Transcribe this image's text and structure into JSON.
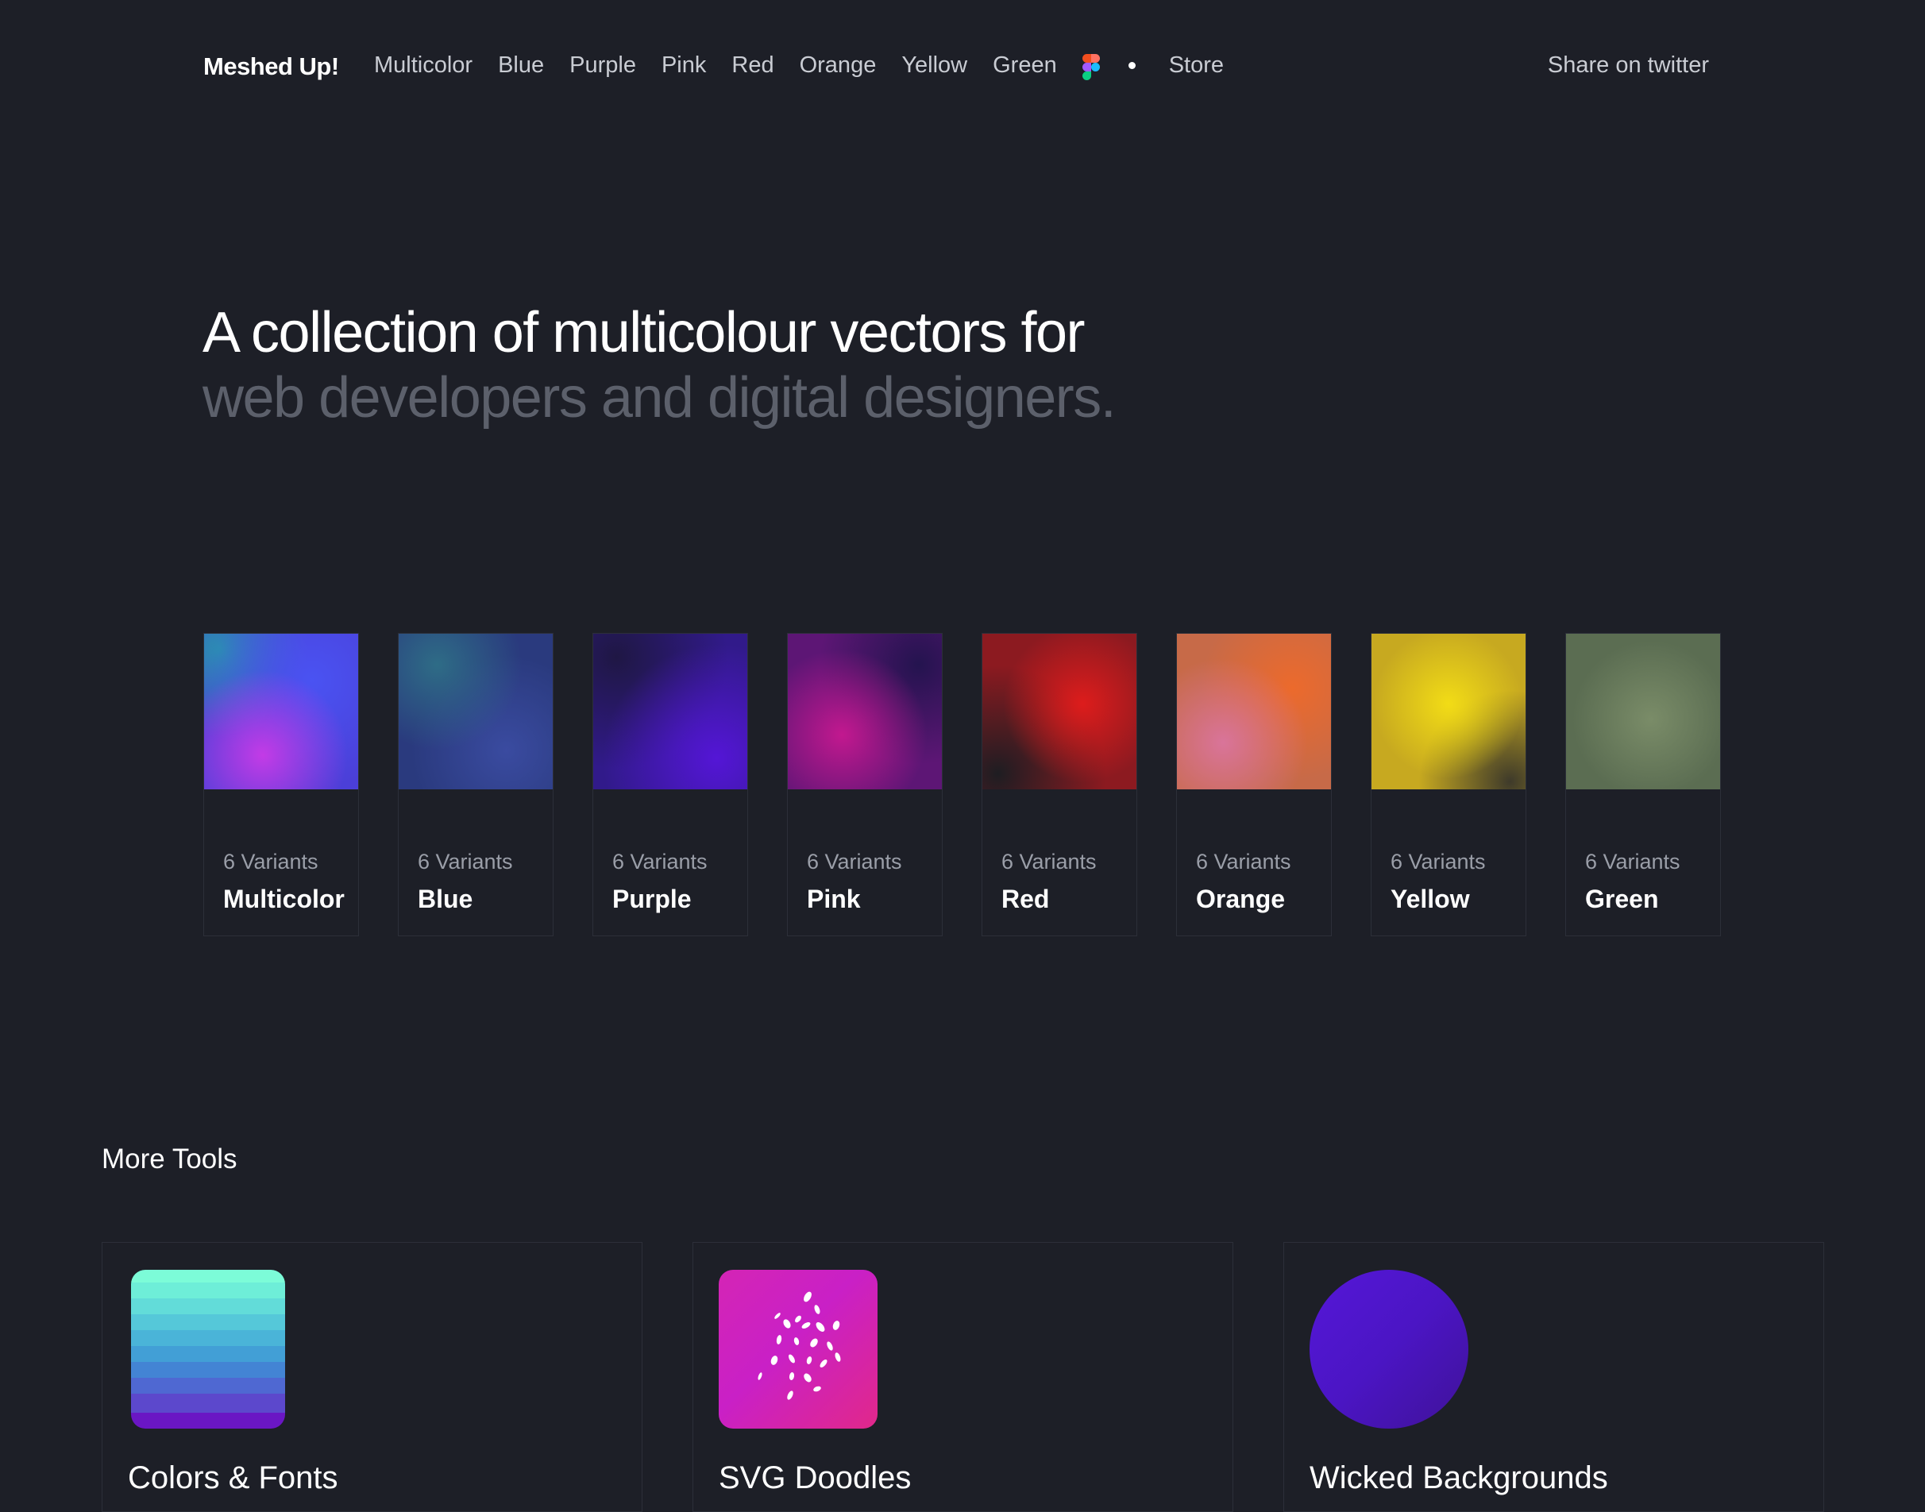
{
  "nav": {
    "brand": "Meshed Up!",
    "links": [
      "Multicolor",
      "Blue",
      "Purple",
      "Pink",
      "Red",
      "Orange",
      "Yellow",
      "Green"
    ],
    "figma_icon": "figma-logo-icon",
    "store": "Store",
    "share": "Share on twitter"
  },
  "hero": {
    "line1": "A collection of multicolour vectors for",
    "line2": "web developers and digital designers."
  },
  "cards": [
    {
      "count": "6 Variants",
      "name": "Multicolor"
    },
    {
      "count": "6 Variants",
      "name": "Blue"
    },
    {
      "count": "6 Variants",
      "name": "Purple"
    },
    {
      "count": "6 Variants",
      "name": "Pink"
    },
    {
      "count": "6 Variants",
      "name": "Red"
    },
    {
      "count": "6 Variants",
      "name": "Orange"
    },
    {
      "count": "6 Variants",
      "name": "Yellow"
    },
    {
      "count": "6 Variants",
      "name": "Green"
    }
  ],
  "more_tools": {
    "title": "More Tools",
    "items": [
      {
        "name": "Colors & Fonts",
        "icon": "color-stripes-icon"
      },
      {
        "name": "SVG Doodles",
        "icon": "doodle-icon"
      },
      {
        "name": "Wicked Backgrounds",
        "icon": "gradient-circle-icon"
      }
    ]
  },
  "colors": {
    "background": "#1d1f27",
    "card_border": "#2c2f39",
    "nav_text": "#c9ccd3",
    "hero_secondary": "#5c606b"
  }
}
